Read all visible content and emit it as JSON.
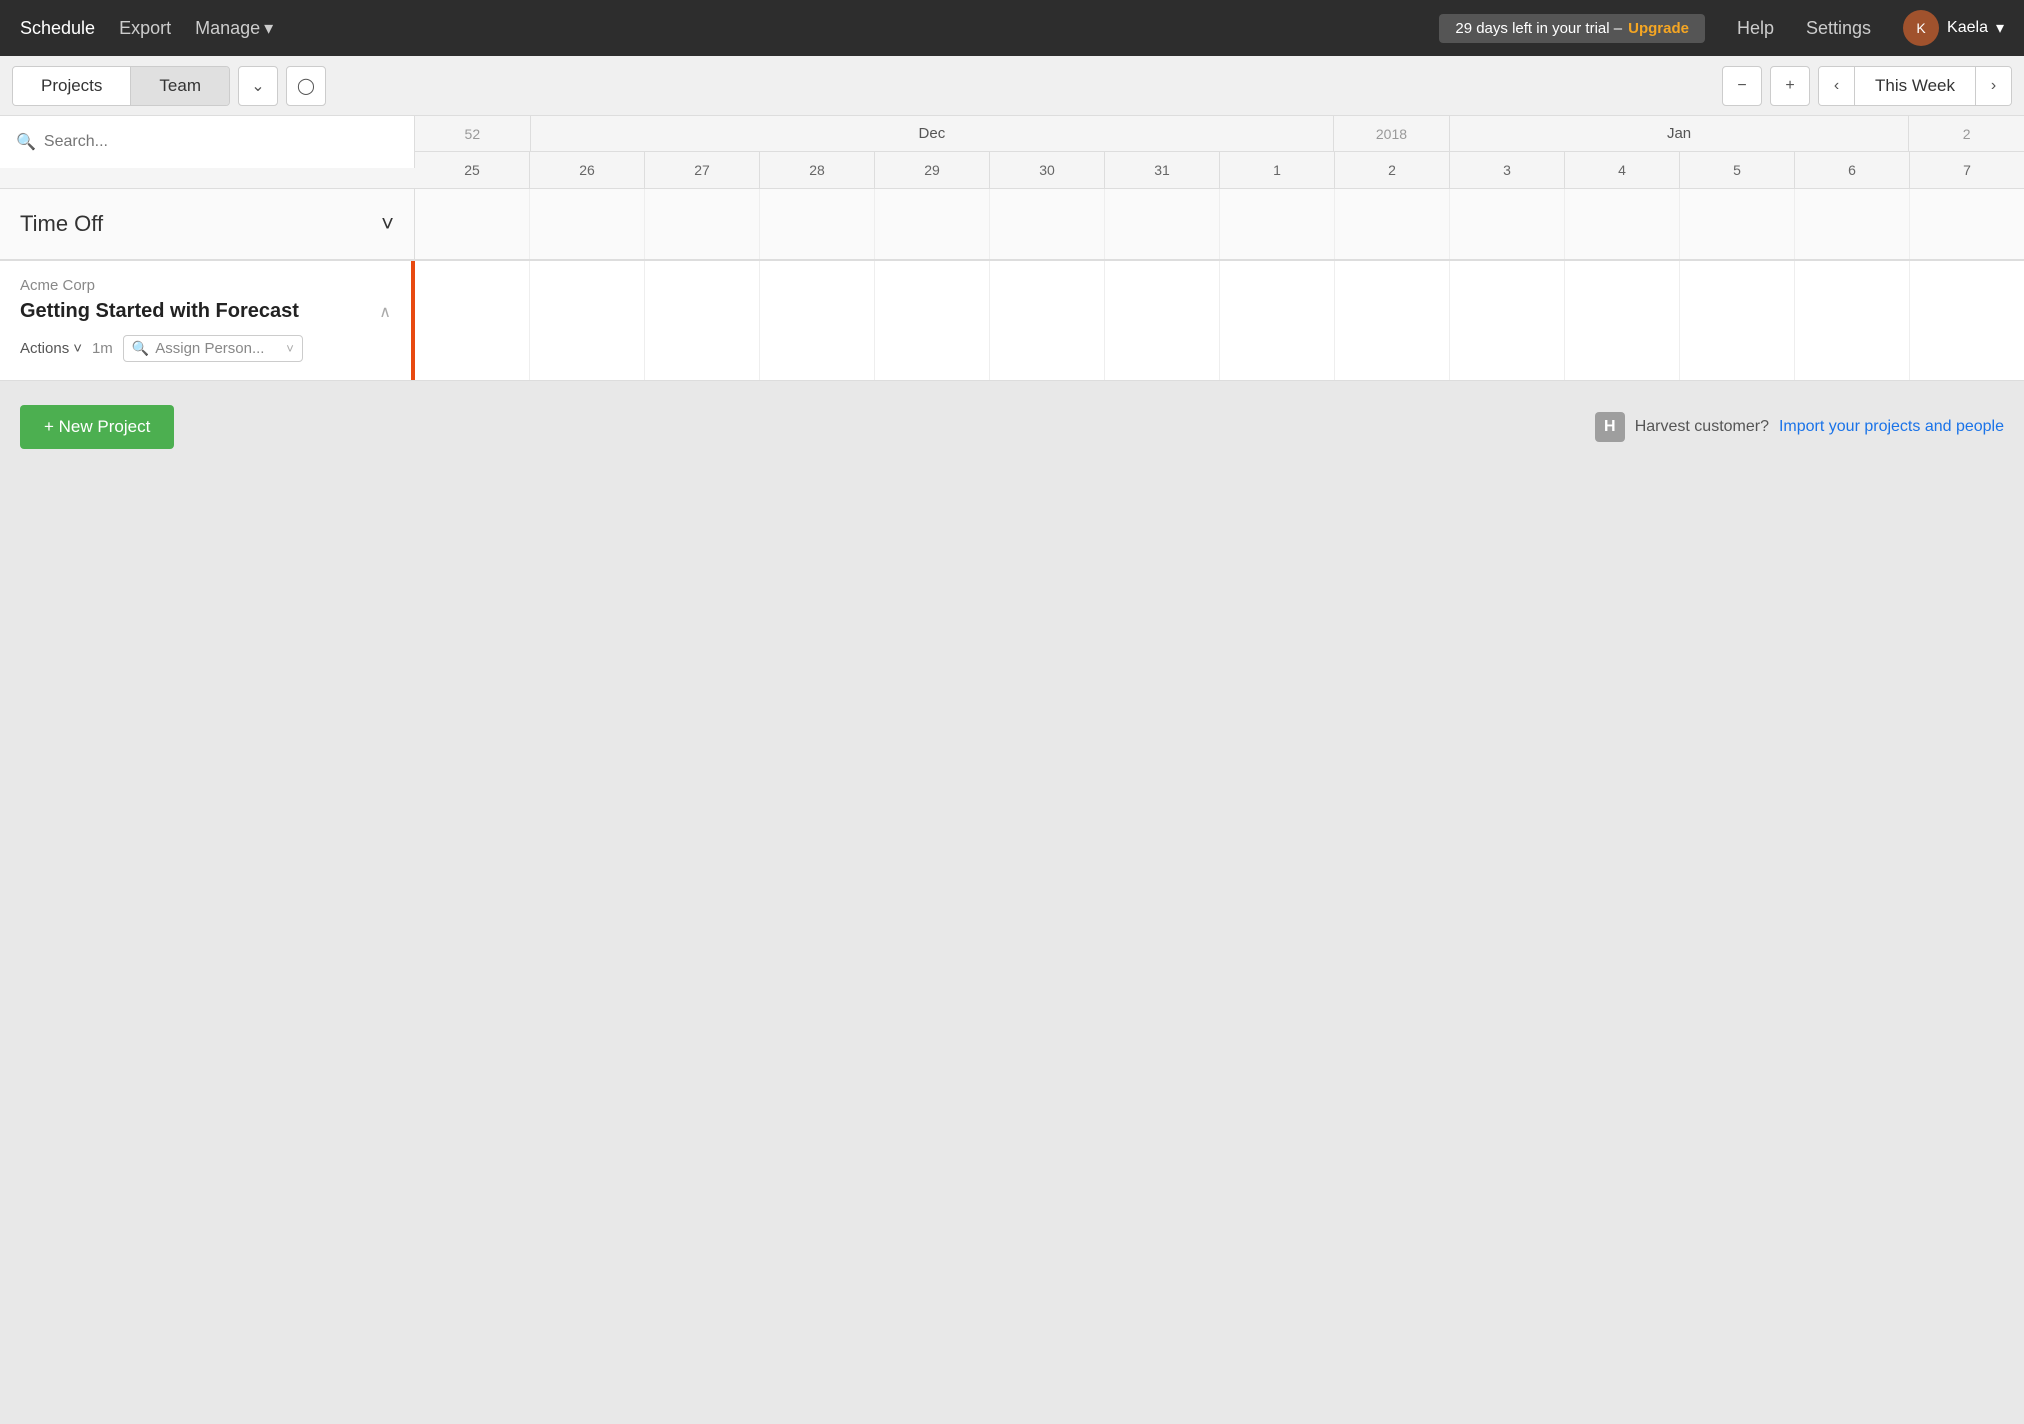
{
  "nav": {
    "schedule": "Schedule",
    "export": "Export",
    "manage": "Manage",
    "manage_chevron": "▾",
    "trial_text": "29 days left in your trial –",
    "upgrade": "Upgrade",
    "help": "Help",
    "settings": "Settings",
    "user": "Kaela",
    "user_chevron": "▾"
  },
  "toolbar": {
    "projects_tab": "Projects",
    "team_tab": "Team",
    "collapse_icon": "⌄",
    "clock_icon": "🕐",
    "zoom_out_icon": "🔍",
    "zoom_in_icon": "🔍",
    "prev_icon": "‹",
    "this_week": "This Week",
    "next_icon": "›"
  },
  "search": {
    "placeholder": "Search..."
  },
  "calendar": {
    "week52": "52",
    "month_dec": "Dec",
    "year2018": "2018",
    "month_jan": "Jan",
    "col2": "2",
    "dates": [
      "25",
      "26",
      "27",
      "28",
      "29",
      "30",
      "31",
      "1",
      "2",
      "3",
      "4",
      "5",
      "6",
      "7"
    ],
    "month_labels": [
      {
        "label": "",
        "span": 1
      },
      {
        "label": "Dec",
        "span": 7
      },
      {
        "label": "2018",
        "span": 1
      },
      {
        "label": "Jan",
        "span": 4
      },
      {
        "label": "",
        "span": 1
      }
    ]
  },
  "time_off": {
    "label": "Time Off",
    "chevron": "˅"
  },
  "project": {
    "client": "Acme Corp",
    "name": "Getting Started with Forecast",
    "chevron": "∧",
    "actions": "Actions",
    "actions_chevron": "˅",
    "duration": "1m",
    "assign_placeholder": "Assign Person...",
    "assign_chevron": "˅"
  },
  "footer": {
    "new_project": "+ New Project",
    "harvest_icon": "H",
    "harvest_text": "Harvest customer?",
    "harvest_link": "Import your projects and people"
  },
  "colors": {
    "orange_border": "#e8490f",
    "green_btn": "#4caf50",
    "blue_link": "#1a73e8",
    "trial_upgrade": "#f5a623"
  }
}
